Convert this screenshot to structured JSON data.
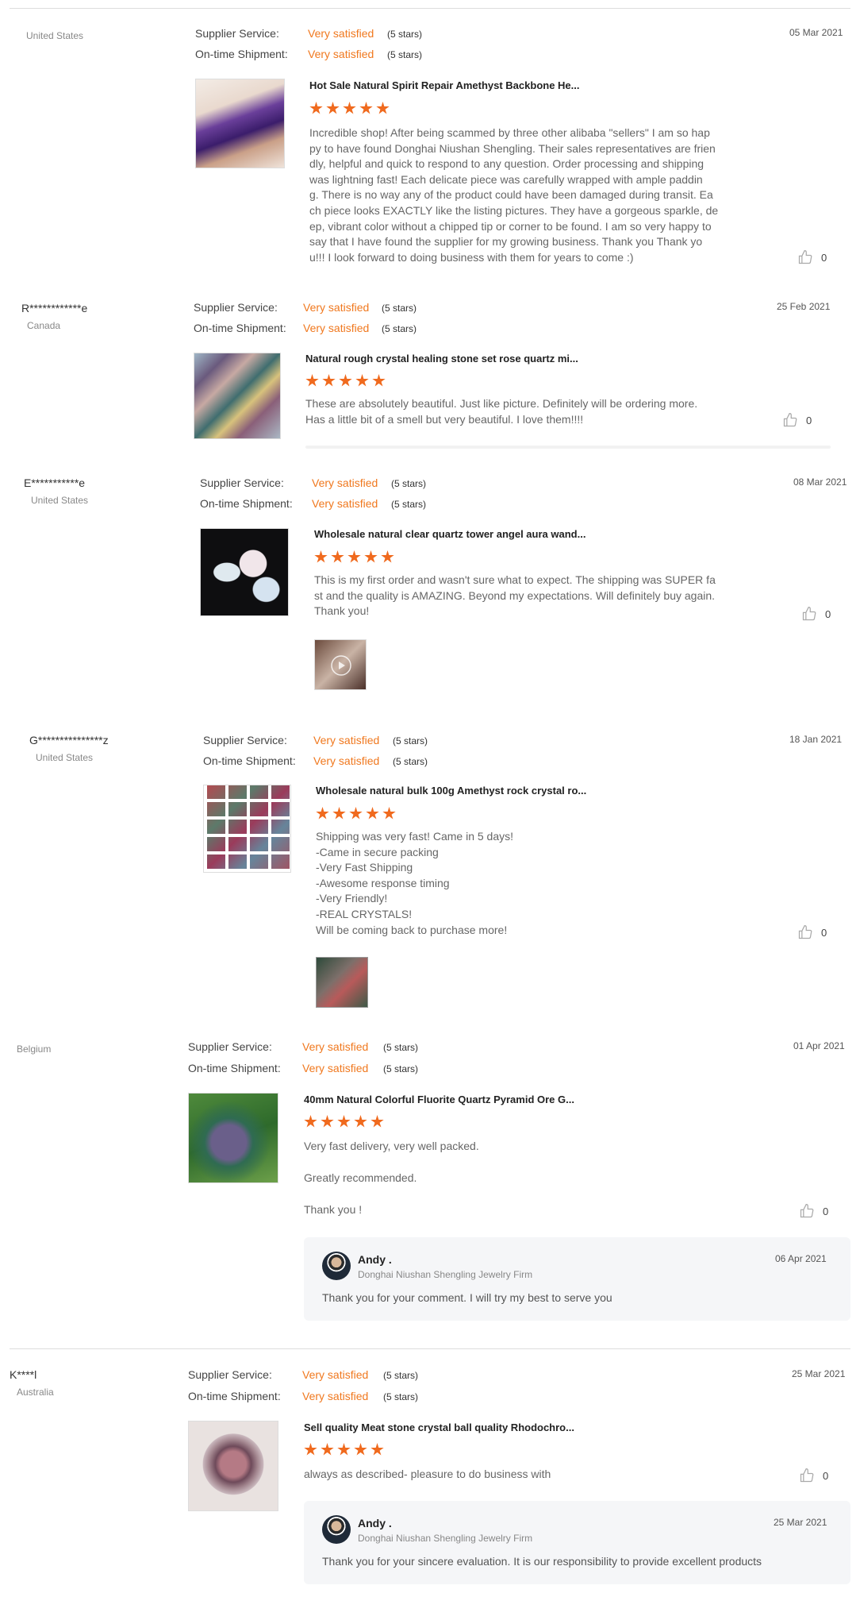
{
  "labels": {
    "service": "Supplier Service:",
    "shipment": "On-time Shipment:"
  },
  "reviews": [
    {
      "user": "",
      "country": "United States",
      "service": "Very satisfied",
      "service_stars": "(5 stars)",
      "shipment": "Very satisfied",
      "shipment_stars": "(5 stars)",
      "date": "05 Mar 2021",
      "product": "Hot Sale Natural Spirit Repair Amethyst Backbone He...",
      "text": "Incredible shop! After being scammed by three other alibaba \"sellers\" I am so hap\npy to have found Donghai Niushan Shengling. Their sales representatives are frien\ndly, helpful and quick to respond to any question. Order processing and shipping\nwas lightning fast! Each delicate piece was carefully wrapped with ample paddin\ng. There is no way any of the product could have been damaged during transit. Ea\nch piece looks EXACTLY like the listing pictures. They have a gorgeous sparkle, de\nep, vibrant color without a chipped tip or corner to be found. I am so very happy to\nsay that I have found the supplier for my growing business. Thank you Thank yo\nu!!! I look forward to doing business with them for years to come :)",
      "likes": "0",
      "rating": 5
    },
    {
      "user": "R************e",
      "country": "Canada",
      "service": "Very satisfied",
      "service_stars": "(5 stars)",
      "shipment": "Very satisfied",
      "shipment_stars": "(5 stars)",
      "date": "25 Feb 2021",
      "product": "Natural rough crystal healing stone set rose quartz mi...",
      "text": "These are absolutely beautiful.  Just like picture.  Definitely will be ordering more.\nHas a little bit of a smell but very beautiful.  I love them!!!!",
      "likes": "0",
      "rating": 5
    },
    {
      "user": "E***********e",
      "country": "United States",
      "service": "Very satisfied",
      "service_stars": "(5 stars)",
      "shipment": "Very satisfied",
      "shipment_stars": "(5 stars)",
      "date": "08 Mar 2021",
      "product": "Wholesale natural clear quartz tower angel aura wand...",
      "text": "This is my first order and wasn't sure what to expect. The shipping was SUPER fa\nst and the quality is AMAZING. Beyond my expectations. Will definitely buy again.\nThank you!",
      "likes": "0",
      "rating": 5
    },
    {
      "user": "G***************z",
      "country": "United States",
      "service": "Very satisfied",
      "service_stars": "(5 stars)",
      "shipment": "Very satisfied",
      "shipment_stars": "(5 stars)",
      "date": "18 Jan 2021",
      "product": "Wholesale natural bulk 100g Amethyst rock crystal ro...",
      "text": "Shipping was very fast! Came in 5 days!\n-Came in secure packing\n-Very Fast Shipping\n-Awesome response timing\n-Very Friendly!\n-REAL CRYSTALS!\nWill be coming back to purchase more!",
      "likes": "0",
      "rating": 5
    },
    {
      "user": "",
      "country": "Belgium",
      "service": "Very satisfied",
      "service_stars": "(5 stars)",
      "shipment": "Very satisfied",
      "shipment_stars": "(5 stars)",
      "date": "01 Apr 2021",
      "product": "40mm Natural Colorful Fluorite Quartz Pyramid Ore G...",
      "text": "Very fast delivery, very well packed.",
      "text2": "Greatly recommended.",
      "text3": "Thank you !",
      "likes": "0",
      "rating": 5,
      "reply": {
        "name": "Andy .",
        "firm": "Donghai Niushan Shengling Jewelry Firm",
        "date": "06 Apr 2021",
        "text": "Thank you for your comment. I will try my best to serve you"
      }
    },
    {
      "user": "K****l",
      "country": "Australia",
      "service": "Very satisfied",
      "service_stars": "(5 stars)",
      "shipment": "Very satisfied",
      "shipment_stars": "(5 stars)",
      "date": "25 Mar 2021",
      "product": "Sell quality Meat stone crystal ball quality Rhodochro...",
      "text": "always as described- pleasure to do business with",
      "likes": "0",
      "rating": 5,
      "reply": {
        "name": "Andy .",
        "firm": "Donghai Niushan Shengling Jewelry Firm",
        "date": "25 Mar 2021",
        "text": "Thank you for your sincere evaluation. It is our responsibility to provide excellent products"
      }
    }
  ]
}
